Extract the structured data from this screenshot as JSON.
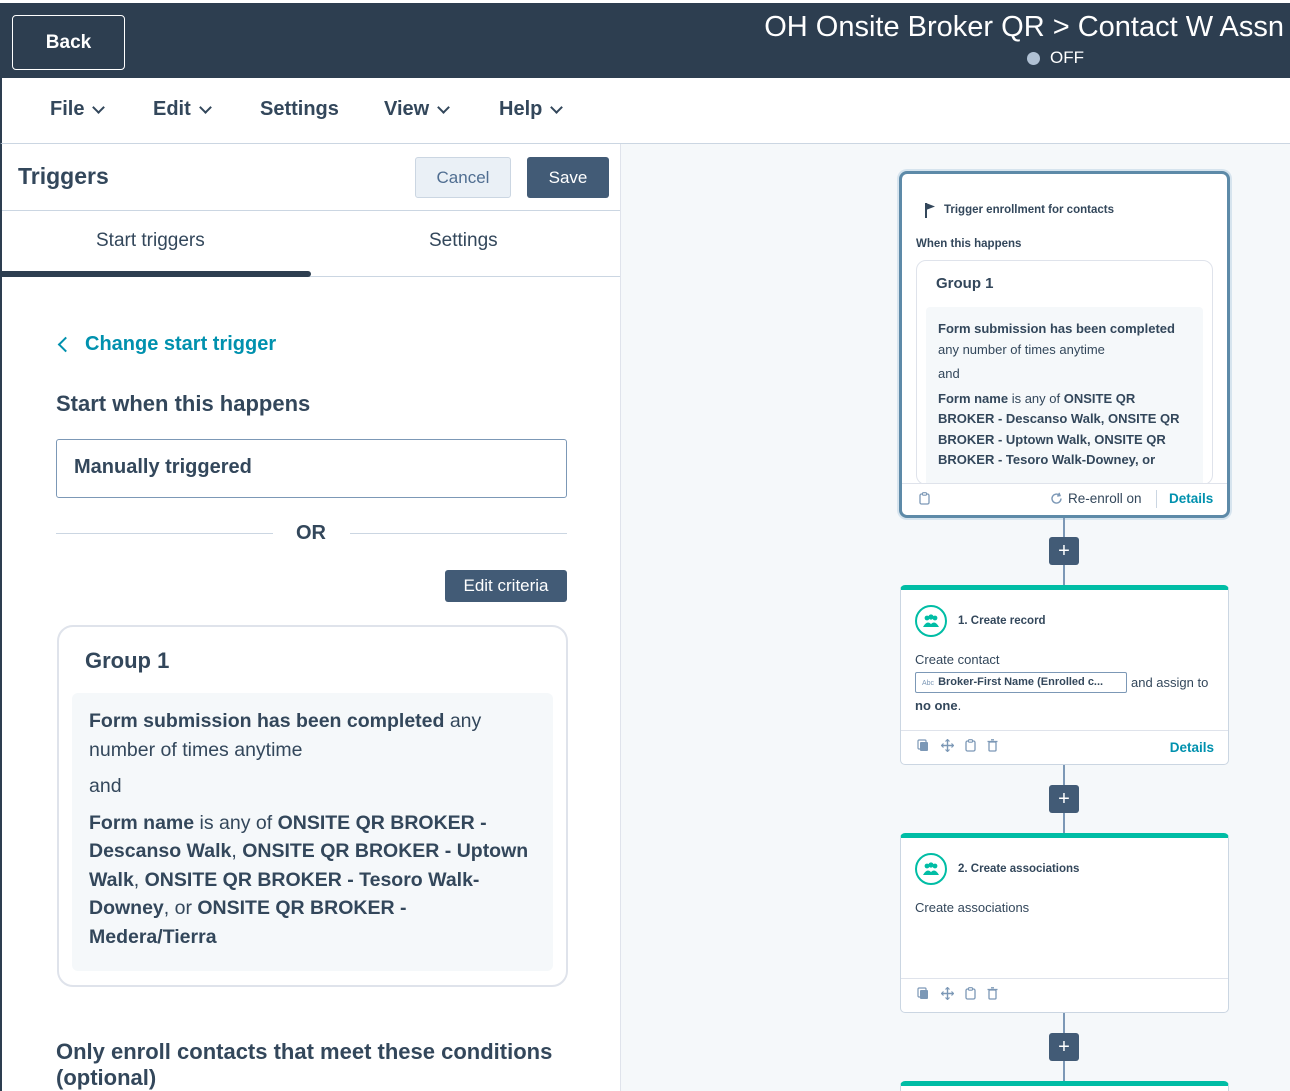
{
  "topbar": {
    "back_label": "Back",
    "workflow_title": "OH Onsite Broker QR > Contact W Assn",
    "status": "OFF"
  },
  "menu": [
    {
      "label": "File",
      "has_dropdown": true
    },
    {
      "label": "Edit",
      "has_dropdown": true
    },
    {
      "label": "Settings",
      "has_dropdown": false
    },
    {
      "label": "View",
      "has_dropdown": true
    },
    {
      "label": "Help",
      "has_dropdown": true
    }
  ],
  "panel": {
    "title": "Triggers",
    "cancel_label": "Cancel",
    "save_label": "Save",
    "tabs": [
      {
        "label": "Start triggers",
        "active": true
      },
      {
        "label": "Settings",
        "active": false
      }
    ],
    "change_trigger_link": "Change start trigger",
    "start_heading": "Start when this happens",
    "manual_trigger": "Manually triggered",
    "or_label": "OR",
    "edit_criteria_label": "Edit criteria",
    "group": {
      "title": "Group 1",
      "condition1_bold": "Form submission has been completed",
      "condition1_rest": " any number of times anytime",
      "and_label": "and",
      "condition2": {
        "field": "Form name",
        "op": " is any of ",
        "v1": "ONSITE QR BROKER - Descanso Walk",
        "sep1": ", ",
        "v2": "ONSITE QR BROKER - Uptown Walk",
        "sep2": ", ",
        "v3": "ONSITE QR BROKER - Tesoro Walk-Downey",
        "sep3": ", or ",
        "v4": "ONSITE QR BROKER - Medera/Tierra"
      }
    },
    "only_enroll_heading": "Only enroll contacts that meet these conditions (optional)"
  },
  "canvas": {
    "trigger_node": {
      "header": "Trigger enrollment for contacts",
      "when_label": "When this happens",
      "group_title": "Group 1",
      "cond1_bold": "Form submission has been completed",
      "cond1_rest": " any number of times anytime",
      "and_label": "and",
      "cond2_field": "Form name",
      "cond2_op": " is any of ",
      "cond2_values": "ONSITE QR BROKER - Descanso Walk, ONSITE QR BROKER - Uptown Walk, ONSITE QR BROKER - Tesoro Walk-Downey, or",
      "reenroll_label": "Re-enroll on",
      "details_label": "Details"
    },
    "actions": [
      {
        "title": "1. Create record",
        "description": "Create contact",
        "token": "Broker-First Name (Enrolled c...",
        "token_prefix": "Abc",
        "assign_text": "and assign to",
        "assignee": "no one",
        "assignee_suffix": ".",
        "details_label": "Details"
      },
      {
        "title": "2. Create associations",
        "description": "Create associations"
      }
    ],
    "plus_symbol": "+"
  },
  "icons": [
    "flag-icon",
    "refresh-icon",
    "clipboard-icon",
    "copy-icon",
    "move-icon",
    "trash-icon",
    "people-icon",
    "chevron-down-icon",
    "chevron-left-icon",
    "plus-icon"
  ],
  "colors": {
    "topbar": "#2d3e50",
    "accent_teal": "#00bda5",
    "link": "#0091ae",
    "button_dark": "#425b76",
    "canvas_bg": "#f5f8fa"
  }
}
